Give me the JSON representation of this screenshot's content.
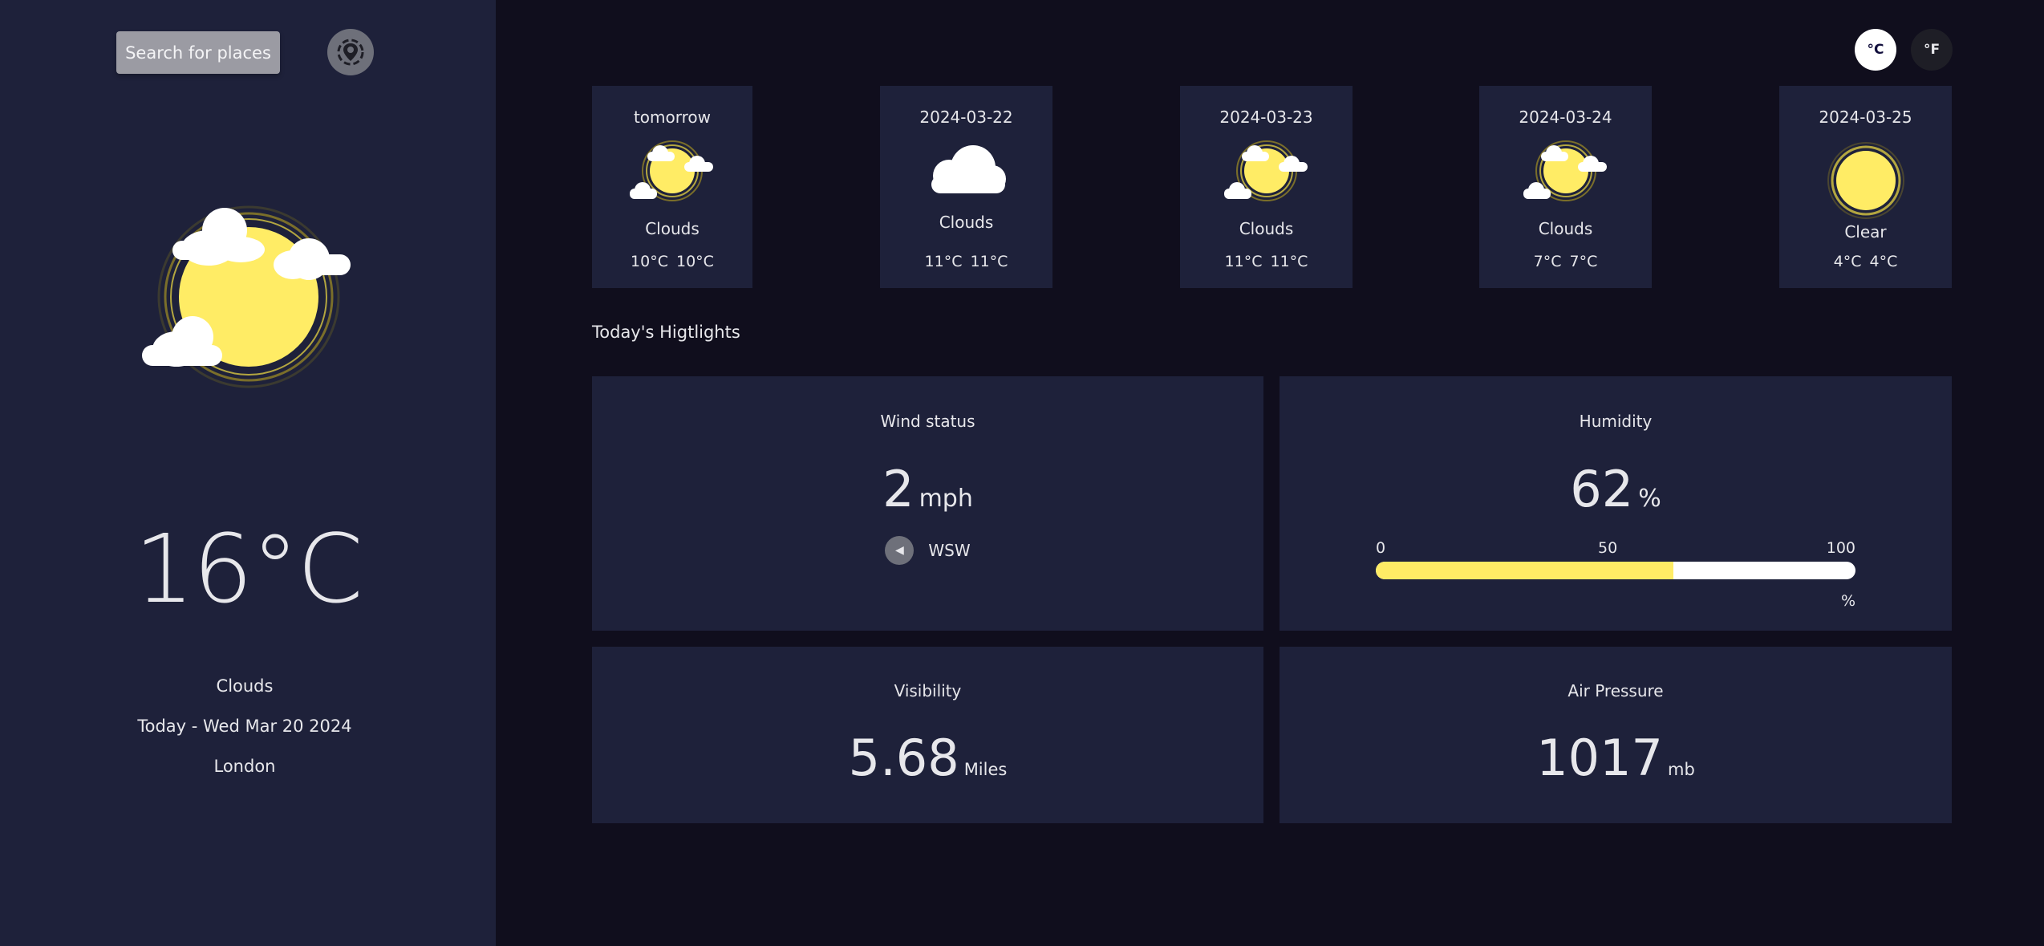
{
  "sidebar": {
    "search_label": "Search for places",
    "locate_icon": "location-target-icon",
    "weather_icon": "sun-with-clouds-icon",
    "temperature": "16°C",
    "condition": "Clouds",
    "date": "Today - Wed Mar 20 2024",
    "location": "London"
  },
  "units": {
    "celsius": "°C",
    "fahrenheit": "°F",
    "selected": "°C"
  },
  "forecast": [
    {
      "title": "tomorrow",
      "icon": "sun-with-clouds-icon",
      "condition": "Clouds",
      "max": "10°C",
      "min": "10°C"
    },
    {
      "title": "2024-03-22",
      "icon": "cloud-icon",
      "condition": "Clouds",
      "max": "11°C",
      "min": "11°C"
    },
    {
      "title": "2024-03-23",
      "icon": "sun-with-clouds-icon",
      "condition": "Clouds",
      "max": "11°C",
      "min": "11°C"
    },
    {
      "title": "2024-03-24",
      "icon": "sun-with-clouds-icon",
      "condition": "Clouds",
      "max": "7°C",
      "min": "7°C"
    },
    {
      "title": "2024-03-25",
      "icon": "sun-icon",
      "condition": "Clear",
      "max": "4°C",
      "min": "4°C"
    }
  ],
  "highlights": {
    "section_title": "Today's Higtlights",
    "wind": {
      "title": "Wind status",
      "value": "2",
      "unit": "mph",
      "direction": "WSW",
      "direction_icon": "navigation-arrow-icon"
    },
    "humidity": {
      "title": "Humidity",
      "value": "62",
      "unit": "%",
      "tick_0": "0",
      "tick_50": "50",
      "tick_100": "100",
      "bar_unit": "%",
      "level_percent": 62
    },
    "visibility": {
      "title": "Visibility",
      "value": "5.68",
      "unit": "Miles"
    },
    "pressure": {
      "title": "Air Pressure",
      "value": "1017",
      "unit": "mb"
    }
  },
  "colors": {
    "sidebar_bg": "#1e213a",
    "page_bg": "#100e1d",
    "sun_yellow": "#ffec65",
    "text": "#e7e7eb"
  }
}
